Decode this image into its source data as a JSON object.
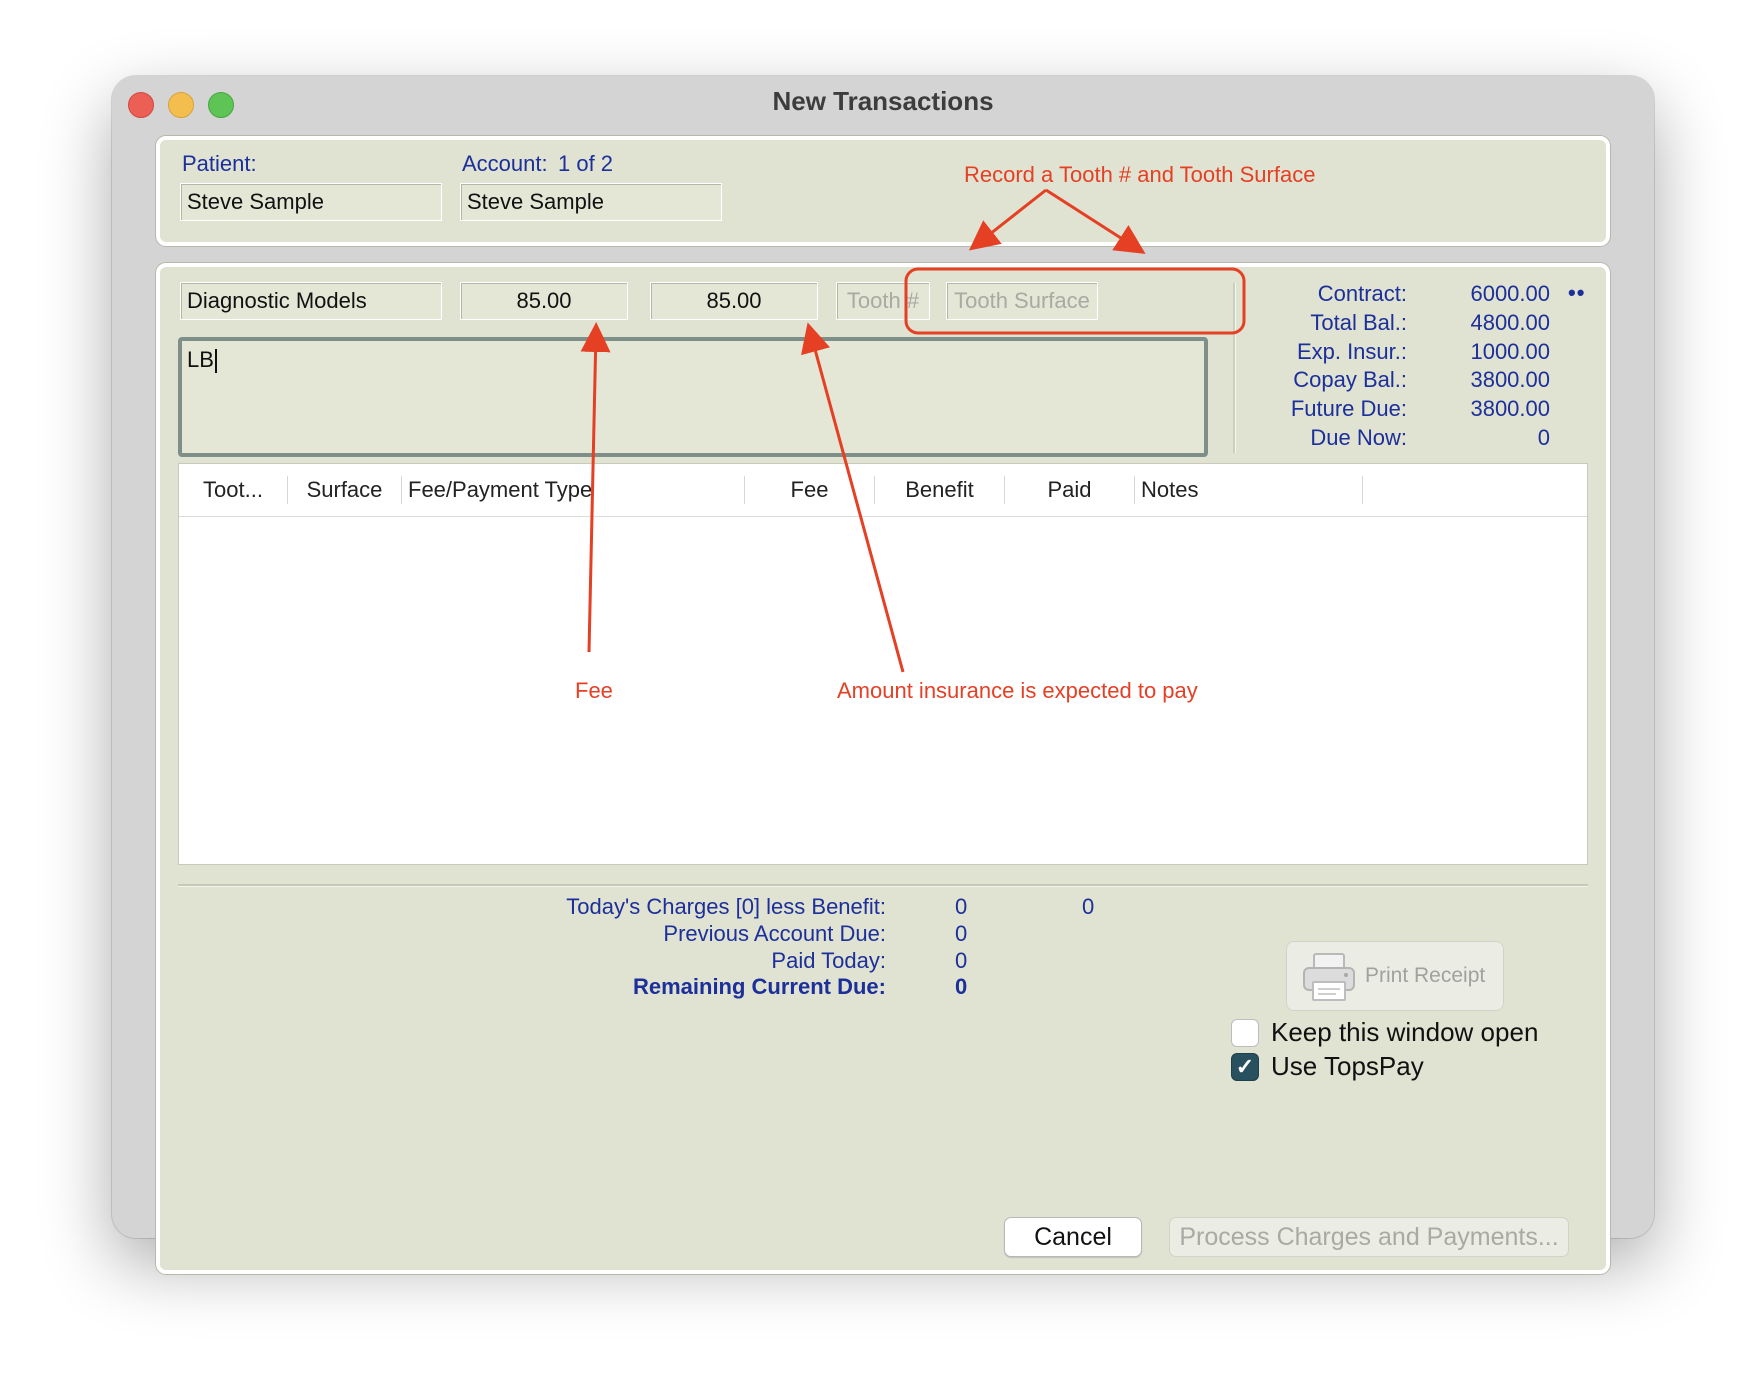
{
  "window": {
    "title": "New Transactions"
  },
  "header": {
    "patient_label": "Patient:",
    "patient_value": "Steve Sample",
    "account_label": "Account:",
    "account_count": "1 of 2",
    "account_value": "Steve Sample"
  },
  "entry": {
    "procedure": "Diagnostic Models",
    "fee": "85.00",
    "benefit": "85.00",
    "tooth_placeholder": "Tooth #",
    "surface_placeholder": "Tooth Surface",
    "notes_value": "LB"
  },
  "summary": {
    "more": "••",
    "rows": [
      {
        "label": "Contract:",
        "value": "6000.00"
      },
      {
        "label": "Total Bal.:",
        "value": "4800.00"
      },
      {
        "label": "Exp. Insur.:",
        "value": "1000.00"
      },
      {
        "label": "Copay Bal.:",
        "value": "3800.00"
      },
      {
        "label": "Future Due:",
        "value": "3800.00"
      },
      {
        "label": "Due Now:",
        "value": "0"
      }
    ]
  },
  "table": {
    "columns": [
      "Toot...",
      "Surface",
      "Fee/Payment Type",
      "Fee",
      "Benefit",
      "Paid",
      "Notes"
    ],
    "rows": []
  },
  "totals": {
    "todays_label": "Today's Charges [0] less Benefit:",
    "todays_value_1": "0",
    "todays_value_2": "0",
    "previous_label": "Previous Account Due:",
    "previous_value": "0",
    "paid_label": "Paid Today:",
    "paid_value": "0",
    "remaining_label": "Remaining Current Due:",
    "remaining_value": "0"
  },
  "actions": {
    "print_receipt": "Print Receipt",
    "keep_open": "Keep this window open",
    "keep_open_checked": false,
    "use_topspay": "Use TopsPay",
    "use_topspay_checked": true,
    "cancel": "Cancel",
    "process": "Process Charges and Payments..."
  },
  "annotations": {
    "tooth": "Record a Tooth # and Tooth Surface",
    "fee": "Fee",
    "insurance": "Amount insurance is expected to pay",
    "color": "#e53f24"
  }
}
